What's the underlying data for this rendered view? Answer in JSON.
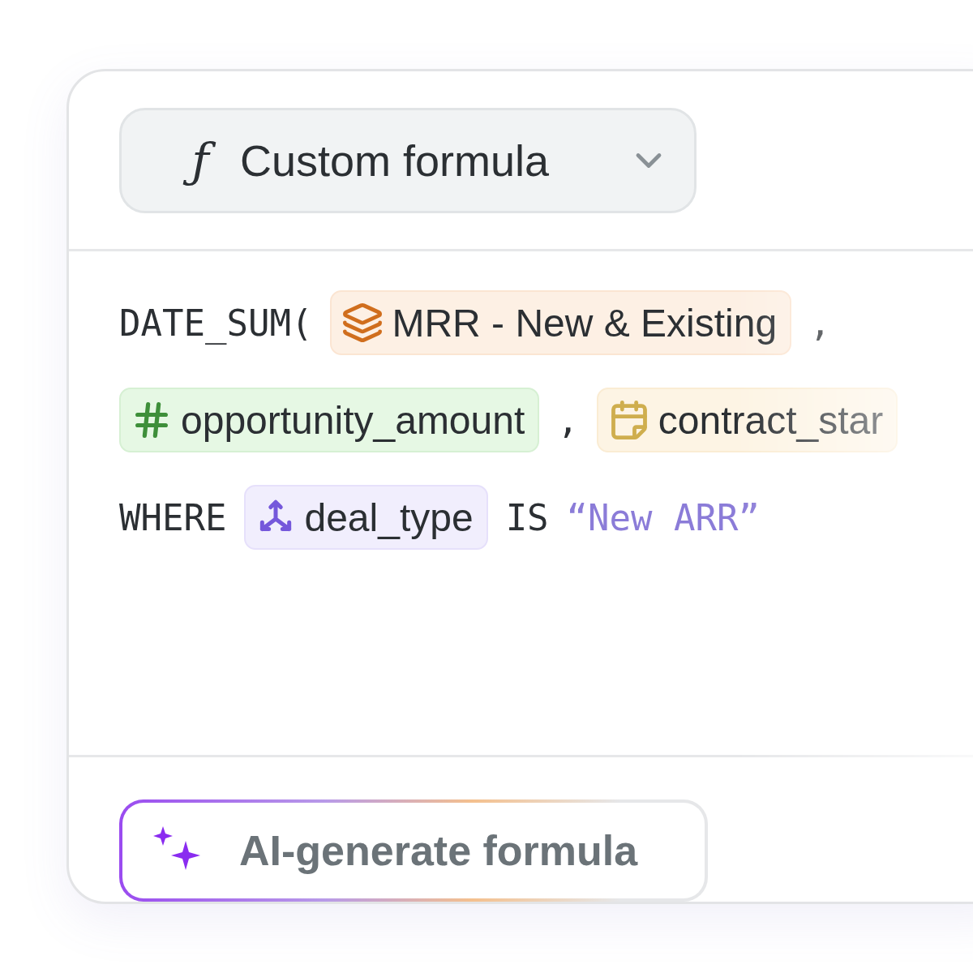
{
  "formula_type": {
    "glyph": "ƒ",
    "label": "Custom formula"
  },
  "formula_lines": [
    {
      "tokens": [
        {
          "kind": "keyword",
          "text": "DATE_SUM("
        },
        {
          "kind": "metric",
          "text": "MRR - New & Existing"
        },
        {
          "kind": "keyword",
          "text": ","
        }
      ]
    },
    {
      "tokens": [
        {
          "kind": "number",
          "text": "opportunity_amount"
        },
        {
          "kind": "keyword",
          "text": ","
        },
        {
          "kind": "date",
          "text": "contract_star"
        }
      ]
    },
    {
      "tokens": [
        {
          "kind": "keyword",
          "text": "WHERE"
        },
        {
          "kind": "category",
          "text": "deal_type"
        },
        {
          "kind": "keyword",
          "text": "IS"
        },
        {
          "kind": "string",
          "text": "“New ARR”"
        }
      ]
    }
  ],
  "ai_button": {
    "label": "AI-generate formula"
  }
}
